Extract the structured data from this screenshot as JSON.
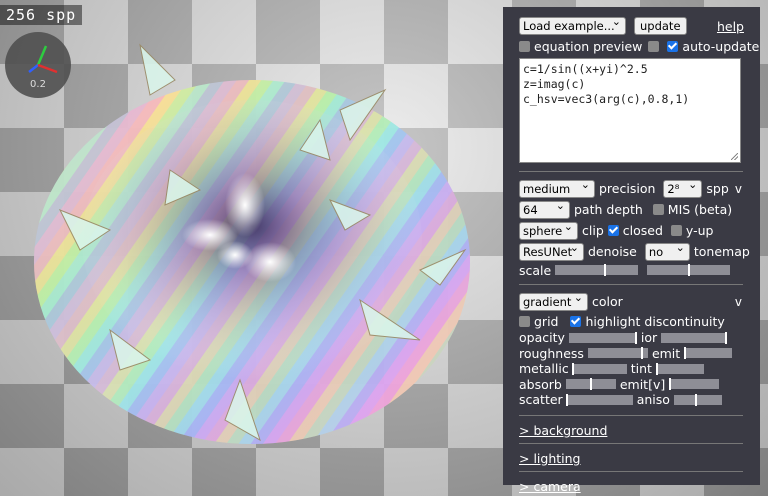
{
  "viewport": {
    "spp_counter": "256 spp",
    "axis_scale": "0.2"
  },
  "panel": {
    "example_select": "Load example...",
    "update_button": "update",
    "help_link": "help",
    "equation_preview_label": "equation preview",
    "auto_update_label": "auto-update",
    "equation_preview_checked": false,
    "auto_update_checked": true,
    "code_lines": [
      "c=1/sin((x+yi)^2.5",
      "z=imag(c)",
      "c_hsv=vec3(arg(c),0.8,1)"
    ],
    "render": {
      "quality_select": "medium",
      "precision_label": "precision",
      "spp_select": "2⁸",
      "spp_label": "spp",
      "collapse_icon": "v",
      "path_depth_select": "64",
      "path_depth_label": "path depth",
      "mis_label": "MIS (beta)",
      "mis_checked": false,
      "clip_select": "sphere",
      "clip_label": "clip",
      "closed_label": "closed",
      "closed_checked": true,
      "y_up_label": "y-up",
      "y_up_checked": false,
      "denoise_select": "ResUNet",
      "denoise_label": "denoise",
      "tonemap_select": "no",
      "tonemap_label": "tonemap",
      "scale_label": "scale",
      "scale_value_1": 0.6,
      "scale_value_2": 0.5
    },
    "material": {
      "color_mode_select": "gradient",
      "color_label": "color",
      "collapse_icon": "v",
      "grid_label": "grid",
      "grid_checked": false,
      "highlight_label": "highlight discontinuity",
      "highlight_checked": true,
      "params": [
        {
          "left_label": "opacity",
          "left_value": 0.98,
          "right_label": "ior",
          "right_value": 0.98
        },
        {
          "left_label": "roughness",
          "left_value": 0.9,
          "right_label": "emit",
          "right_value": 0.02
        },
        {
          "left_label": "metallic",
          "left_value": 0.0,
          "right_label": "tint",
          "right_value": 0.02
        },
        {
          "left_label": "absorb",
          "left_value": 0.5,
          "right_label": "emit[v]",
          "right_value": 0.02
        },
        {
          "left_label": "scatter",
          "left_value": 0.0,
          "right_label": "aniso",
          "right_value": 0.45
        }
      ]
    },
    "sections": {
      "background": "> background",
      "lighting": "> lighting",
      "camera": "> camera"
    }
  }
}
